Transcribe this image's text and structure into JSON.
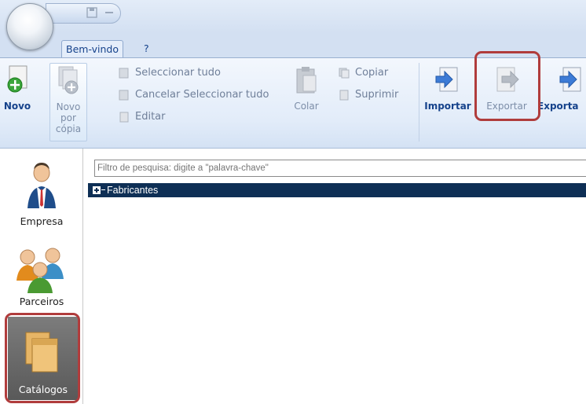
{
  "quick_access": {
    "icons": [
      "save-icon",
      "minus-icon"
    ]
  },
  "tabs": [
    {
      "label": "Bem-vindo",
      "active": true
    },
    {
      "label": "?"
    }
  ],
  "ribbon": {
    "new_label": "Novo",
    "copy_new_label_1": "Novo por",
    "copy_new_label_2": "cópia",
    "select_all_label": "Seleccionar tudo",
    "cancel_select_all_label": "Cancelar Seleccionar tudo",
    "edit_label": "Editar",
    "paste_label": "Colar",
    "copy_label": "Copiar",
    "delete_label": "Suprimir",
    "import_label": "Importar",
    "export_label": "Exportar",
    "export2_label": "Exporta"
  },
  "nav": [
    {
      "label": "Empresa",
      "icon": "businessman-icon"
    },
    {
      "label": "Parceiros",
      "icon": "people-group-icon"
    },
    {
      "label": "Catálogos",
      "icon": "folders-icon",
      "selected": true
    }
  ],
  "search": {
    "placeholder": "Filtro de pesquisa: digite a \"palavra-chave\""
  },
  "tree": {
    "rows": [
      {
        "label": "Fabricantes",
        "expanded": false,
        "selected": true
      }
    ]
  },
  "colors": {
    "highlight": "#b03c3c",
    "selected_row": "#0e2f55",
    "nav_selected": "#6a6a6a",
    "ribbon_text": "#15428b"
  }
}
